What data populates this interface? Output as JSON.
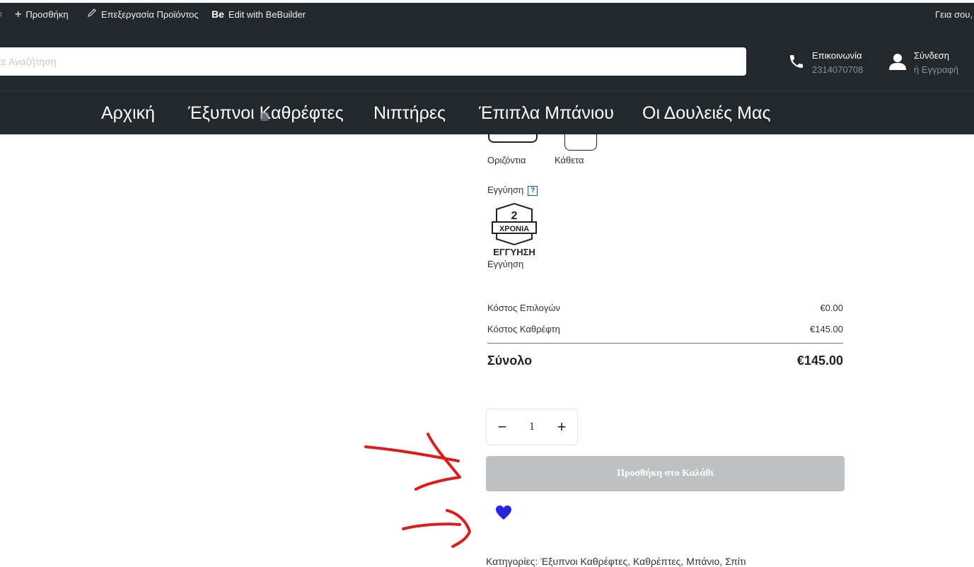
{
  "adminbar": {
    "add_label": "Προσθήκη",
    "edit_product_label": "Επεξεργασία Προϊόντος",
    "bebuilder_label": "Edit with BeBuilder",
    "bebuilder_logo": "Be",
    "greeting": "Γεια σου,"
  },
  "header": {
    "search_placeholder": "ντε Αναζήτηση",
    "contact_title": "Επικοινωνία",
    "contact_phone": "2314070708",
    "login_title": "Σύνδεση",
    "login_sub": "ή Εγγραφή"
  },
  "nav": {
    "items": [
      "Αρχική",
      "Έξυπνοι Καθρέφτες",
      "Νιπτήρες",
      "Έπιπλα Μπάνιου",
      "Οι Δουλειές Μας"
    ]
  },
  "options": {
    "horizontal_label": "Οριζόντια",
    "vertical_label": "Κάθετα",
    "warranty_title": "Εγγύηση",
    "help_mark": "?",
    "warranty_option_label": "Εγγύηση",
    "badge": {
      "number": "2",
      "years": "ΧΡΟΝΙΑ",
      "text": "ΕΓΓΥΗΣΗ"
    }
  },
  "pricing": {
    "options_cost_label": "Κόστος Επιλογών",
    "options_cost_value": "€0.00",
    "mirror_cost_label": "Κόστος Καθρέφτη",
    "mirror_cost_value": "€145.00",
    "total_label": "Σύνολο",
    "total_value": "€145.00"
  },
  "cart": {
    "minus": "−",
    "plus": "+",
    "quantity": "1",
    "add_to_cart_label": "Προσθήκη στο Καλάθι",
    "disabled": true
  },
  "categories_text": "Κατηγορίες: Έξυπνοι Καθρέφτες, Καθρέπτες, Μπάνιο, Σπίτι",
  "colors": {
    "dark": "#23282d",
    "button_disabled": "#bfc0c2",
    "heart": "#2a24e0",
    "annotation": "#e01b1b"
  },
  "icons": [
    "plus-icon",
    "pencil-icon",
    "phone-icon",
    "user-icon",
    "heart-icon"
  ]
}
